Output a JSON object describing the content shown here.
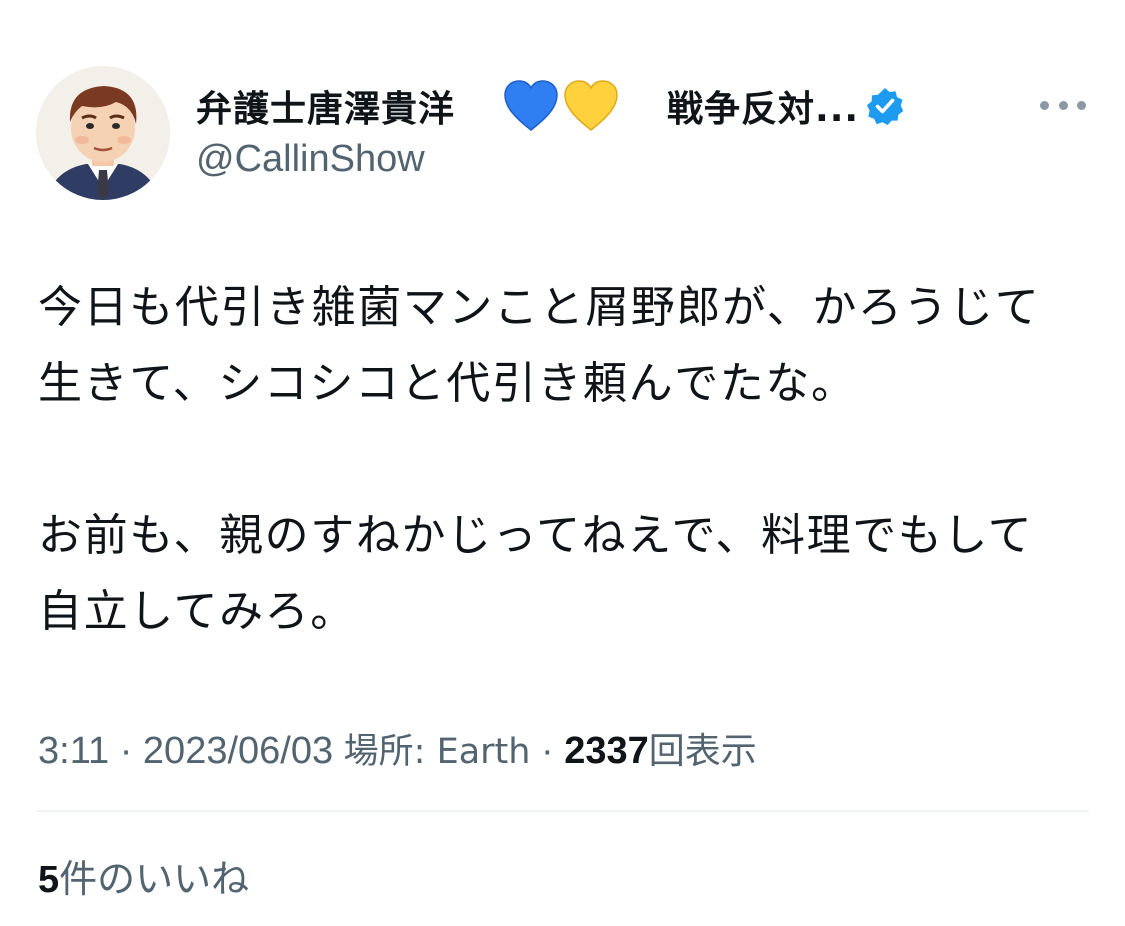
{
  "header": {
    "display_name": "弁護士唐澤貴洋",
    "display_name_suffix": "戦争反対...",
    "handle": "@CallinShow",
    "hearts": [
      "blue-heart",
      "yellow-heart"
    ],
    "verified": true
  },
  "tweet": {
    "paragraphs": [
      [
        "今日も代引き雑菌マンこと屑野郎が、かろうじて",
        "生きて、シコシコと代引き頼んでたな。"
      ],
      [
        "お前も、親のすねかじってねえで、料理でもして",
        "自立してみろ。"
      ]
    ]
  },
  "meta": {
    "time": "3:11",
    "separator": "·",
    "date": "2023/06/03",
    "place": "場所: Earth",
    "views_count": "2337",
    "views_label": "回表示"
  },
  "likes": {
    "count": "5",
    "label": "件のいいね"
  },
  "colors": {
    "text_primary": "#0f1419",
    "text_secondary": "#536471",
    "verified_blue": "#1d9bf0",
    "divider": "#eff3f4"
  }
}
